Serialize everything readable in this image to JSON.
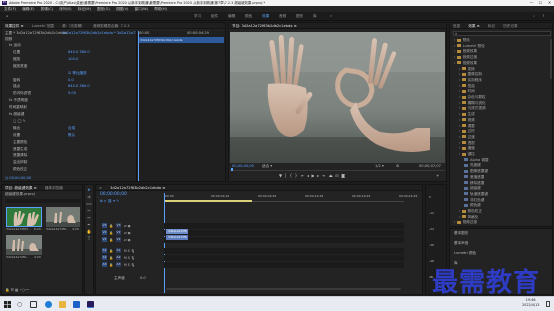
{
  "window": {
    "title": "Adobe Premiere Pro 2020 - C:\\用户\\Alas\\桌面\\最需要\\Premiere Pro 2020 从新手到精通\\最需要\\Premiere Pro 2020 从新手到精通\\第7章\\7.2.3 超级键效果.prproj *",
    "app_badge": "Pr",
    "controls": [
      "—",
      "☐",
      "✕"
    ]
  },
  "menu": [
    "文件(F)",
    "编辑(E)",
    "剪辑(C)",
    "序列(S)",
    "标记(M)",
    "图形(G)",
    "视图(V)",
    "窗口(W)",
    "帮助(H)"
  ],
  "workspaces": [
    "学习",
    "组件",
    "编辑",
    "颜色",
    "效果",
    "音频",
    "图形",
    "库"
  ],
  "workspaces_active": "效果",
  "effect_controls": {
    "tabs": [
      "效果控件 ≡",
      "Lumetri 范围",
      "源:（无剪辑）",
      "音频剪辑混合器: 7.2.3"
    ],
    "source_label": "主要 * 3d2a12a72f63b2db2c1ebda",
    "clip_label": "3d2a12a72f63b2db2c1ebda * 3d2a12a72f63b2db2c1ebda",
    "section_video": "视频",
    "rows": [
      {
        "label": "fx 运动",
        "value": "",
        "indent": 1
      },
      {
        "label": "位置",
        "value": "640.0   360.0",
        "indent": 2
      },
      {
        "label": "缩放",
        "value": "100.0",
        "indent": 2
      },
      {
        "label": "缩放宽度",
        "value": "",
        "indent": 2
      },
      {
        "label": "",
        "value": "☑ 等比缩放",
        "indent": 3
      },
      {
        "label": "旋转",
        "value": "0.0",
        "indent": 2
      },
      {
        "label": "锚点",
        "value": "640.0   360.0",
        "indent": 2
      },
      {
        "label": "防闪烁滤镜",
        "value": "0.00",
        "indent": 2
      },
      {
        "label": "fx 不透明度",
        "value": "",
        "indent": 1
      },
      {
        "label": "时间重映射",
        "value": "",
        "indent": 1
      },
      {
        "label": "fx 超级键",
        "value": "",
        "indent": 1
      },
      {
        "label": "□ ◯ ✎",
        "value": "",
        "indent": 2
      },
      {
        "label": "输出",
        "value": "合成",
        "indent": 2
      },
      {
        "label": "设置",
        "value": "默认",
        "indent": 2
      },
      {
        "label": "主要颜色",
        "value": "",
        "indent": 2
      },
      {
        "label": "遮罩生成",
        "value": "",
        "indent": 2
      },
      {
        "label": "遮罩清除",
        "value": "",
        "indent": 2
      },
      {
        "label": "溢出抑制",
        "value": "",
        "indent": 2
      },
      {
        "label": "颜色校正",
        "value": "",
        "indent": 2
      }
    ],
    "mini_timecode": "00:00",
    "mini_ruler": "00:00:04:29",
    "mini_clip": "3d2a12a72f63b2db2c1ebda"
  },
  "program_monitor": {
    "tab": "节目: 3d2a12a72f63b2db2c1ebda ≡",
    "timecode": "00;00;00;00",
    "fit": "适合",
    "quality": "1/2",
    "duration": "00;00;07;07"
  },
  "effects_panel": {
    "tabs": [
      "信息",
      "效果 ≡",
      "标记",
      "历史记录"
    ],
    "items": [
      {
        "label": "预设",
        "indent": 0
      },
      {
        "label": "Lumetri 预设",
        "indent": 0
      },
      {
        "label": "音频效果",
        "indent": 0
      },
      {
        "label": "音频过渡",
        "indent": 0
      },
      {
        "label": "视频效果",
        "indent": 0
      },
      {
        "label": "变换",
        "indent": 1
      },
      {
        "label": "图像控制",
        "indent": 1
      },
      {
        "label": "实用程序",
        "indent": 1
      },
      {
        "label": "扭曲",
        "indent": 1
      },
      {
        "label": "时间",
        "indent": 1
      },
      {
        "label": "杂色与颗粒",
        "indent": 1
      },
      {
        "label": "模糊与锐化",
        "indent": 1
      },
      {
        "label": "沉浸式视频",
        "indent": 1
      },
      {
        "label": "生成",
        "indent": 1
      },
      {
        "label": "视频",
        "indent": 1
      },
      {
        "label": "调整",
        "indent": 1
      },
      {
        "label": "过时",
        "indent": 1
      },
      {
        "label": "过渡",
        "indent": 1
      },
      {
        "label": "透视",
        "indent": 1
      },
      {
        "label": "通道",
        "indent": 1
      },
      {
        "label": "键控",
        "indent": 1
      },
      {
        "label": "Alpha 调整",
        "indent": 2
      },
      {
        "label": "亮度键",
        "indent": 2
      },
      {
        "label": "图像遮罩键",
        "indent": 2
      },
      {
        "label": "差值遮罩",
        "indent": 2
      },
      {
        "label": "移除遮罩",
        "indent": 2
      },
      {
        "label": "超级键",
        "indent": 2
      },
      {
        "label": "轨道遮罩键",
        "indent": 2
      },
      {
        "label": "非红色键",
        "indent": 2
      },
      {
        "label": "颜色键",
        "indent": 2
      },
      {
        "label": "颜色校正",
        "indent": 1
      },
      {
        "label": "风格化",
        "indent": 1
      },
      {
        "label": "视频过渡",
        "indent": 0
      }
    ],
    "sub_panels": [
      "基本图形",
      "基本声音",
      "Lumetri 颜色",
      "库"
    ]
  },
  "project": {
    "tabs": [
      "项目: 超级键效果 ≡",
      "媒体浏览器"
    ],
    "path": "超级键效果.prproj",
    "items": [
      {
        "label": "3d2a12a72f63...",
        "duration": "6:29"
      },
      {
        "label": "3d2a12a72f6...",
        "duration": "4:29"
      },
      {
        "label": "3d2a12a72f6...",
        "duration": "4:29"
      }
    ]
  },
  "timeline": {
    "tab": "3d2a12a72f63b2db2c1ebda ≡",
    "timecode": "00;00;00;00",
    "ruler": [
      ":00:00",
      "00;00;04;29",
      "00;00;09;29",
      "00;00;14;29",
      "00;00;19;29",
      "00;00;24;29"
    ],
    "tracks": [
      "V3",
      "V2",
      "V1",
      "A1",
      "A2",
      "A3"
    ],
    "master": "主声道",
    "master_value": "0.0",
    "clips": [
      {
        "label": "3d2a12a72f6",
        "track": "V2"
      },
      {
        "label": "3d2a12a72f6",
        "track": "V1"
      }
    ],
    "db": [
      "0",
      "-12",
      "-24",
      "-36",
      "-48",
      "dB"
    ]
  },
  "taskbar": {
    "time": "19:46",
    "date": "2022/4/13"
  },
  "watermark": "最需教育"
}
